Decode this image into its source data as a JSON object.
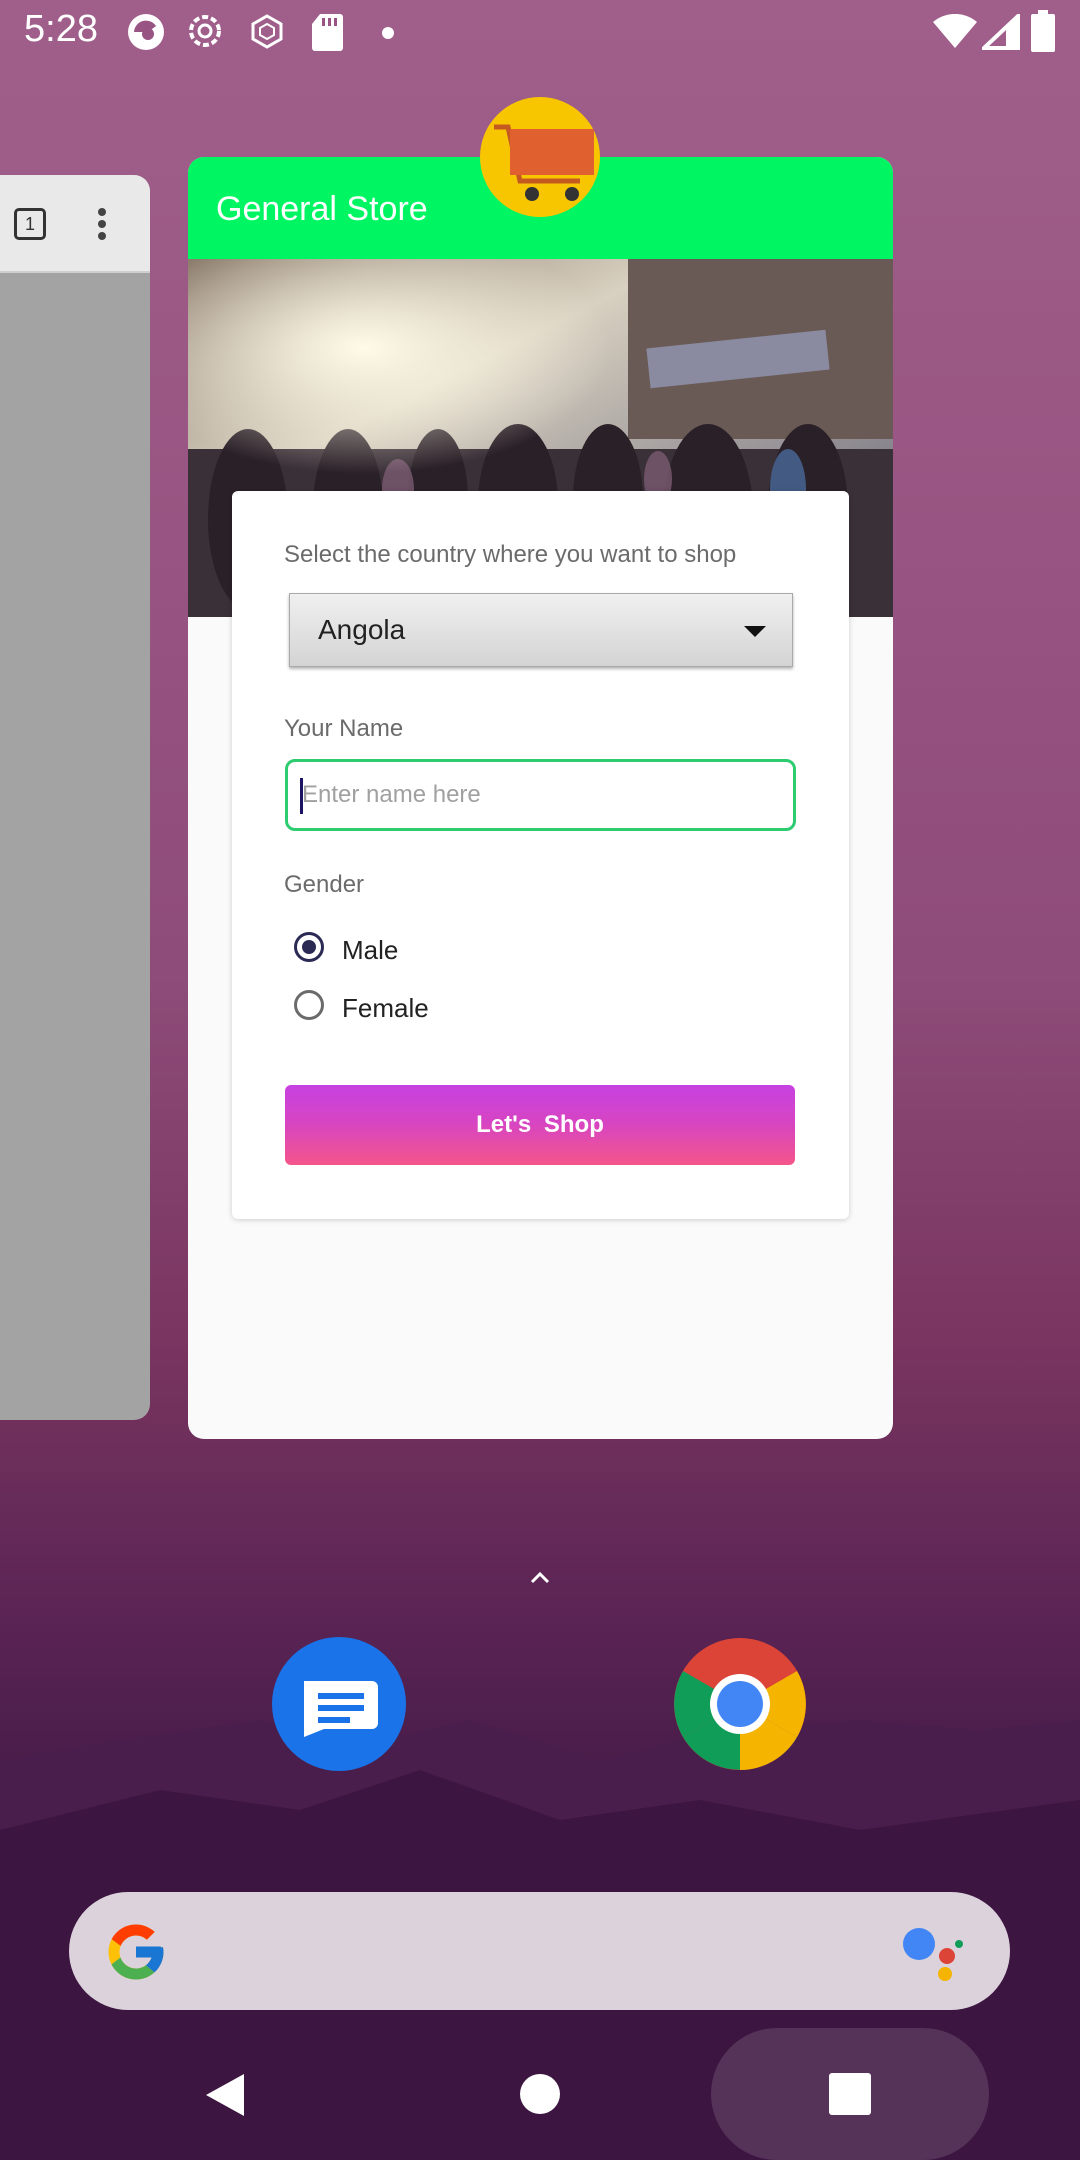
{
  "status_bar": {
    "time": "5:28"
  },
  "recent_app": {
    "title": "General Store",
    "form": {
      "country_label": "Select the country where you want to shop",
      "country_selected": "Angola",
      "name_label": "Your Name",
      "name_placeholder": "Enter name here",
      "name_value": "",
      "gender_label": "Gender",
      "gender_options": [
        "Male",
        "Female"
      ],
      "gender_selected": "Male",
      "submit_label": "Let's  Shop"
    },
    "colors": {
      "header": "#00f563",
      "button_top": "#c641e2",
      "button_bottom": "#f4568a",
      "input_border": "#2ecc71"
    }
  },
  "left_card": {
    "tab_count": "1"
  },
  "dock": {
    "apps": [
      "messages-icon",
      "chrome-icon"
    ]
  },
  "icons": [
    "wifi-icon",
    "signal-icon",
    "battery-icon",
    "google-g-icon",
    "assistant-icon",
    "back-icon",
    "home-icon",
    "recents-icon",
    "shopping-cart-icon"
  ]
}
